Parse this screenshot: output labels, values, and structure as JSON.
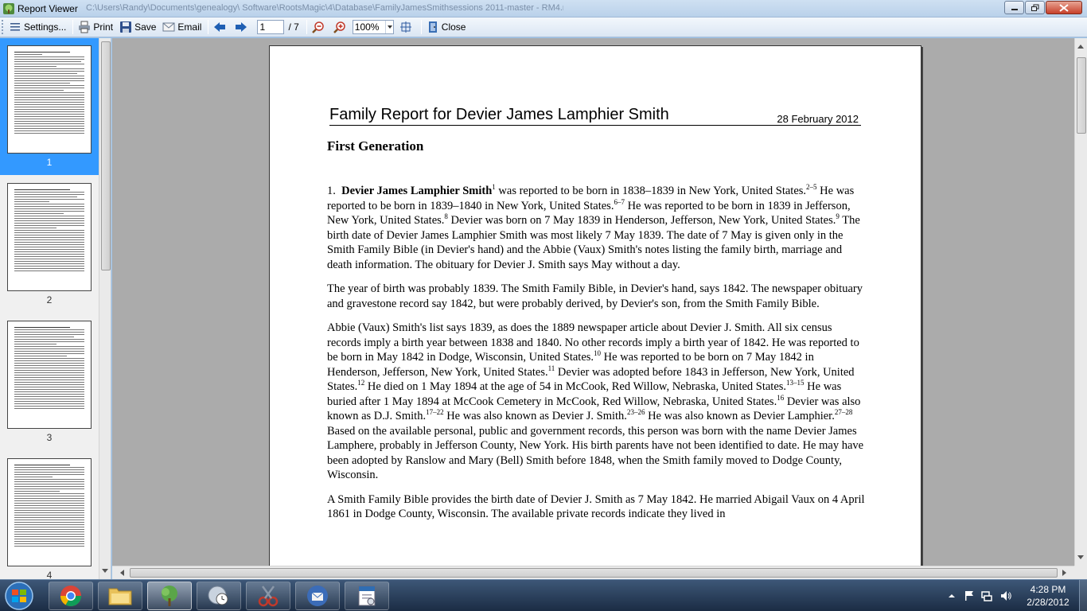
{
  "window": {
    "title": "Report Viewer",
    "path": "C:\\Users\\Randy\\Documents\\genealogy\\ Software\\RootsMagic\\4\\Database\\FamilyJamesSmithsessions 2011-master - RM4.rmgc"
  },
  "toolbar": {
    "settings": "Settings...",
    "print": "Print",
    "save": "Save",
    "email": "Email",
    "page_value": "1",
    "page_total": "/ 7",
    "zoom": "100%",
    "close": "Close"
  },
  "thumbnails": [
    {
      "num": "1",
      "selected": true
    },
    {
      "num": "2",
      "selected": false
    },
    {
      "num": "3",
      "selected": false
    },
    {
      "num": "4",
      "selected": false
    }
  ],
  "report": {
    "title": "Family Report for Devier James Lamphier Smith",
    "date": "28 February 2012",
    "generation": "First Generation",
    "p1": {
      "num": "1.",
      "name": "Devier James Lamphier Smith",
      "s1": "1",
      "t1": " was reported to be born in 1838–1839 in New York, United States.",
      "s2": "2–5",
      "t2": " He was reported to be born in 1839–1840 in New York, United States.",
      "s3": "6–7",
      "t3": " He was reported to be born in 1839 in Jefferson, New York, United States.",
      "s4": "8",
      "t4": " Devier was born on 7 May 1839 in Henderson, Jefferson, New York, United States.",
      "s5": "9",
      "t5": " The birth date of Devier James Lamphier Smith was most likely 7 May 1839.  The date of 7 May is given only in the Smith Family Bible (in Devier's hand) and the Abbie (Vaux) Smith's notes listing the family birth, marriage and death information.  The obituary for Devier J. Smith says May without a day."
    },
    "p2": "The year of birth was probably 1839.  The Smith Family Bible, in Devier's hand, says 1842.  The newspaper obituary and gravestone record say 1842, but were probably derived, by Devier's son, from the Smith Family Bible.",
    "p3": {
      "t1": "Abbie (Vaux) Smith's  list says 1839, as does the 1889 newspaper article about Devier J. Smith.  All six census records imply a birth year between 1838 and 1840.  No other records imply a birth year of 1842.  He was reported to be born in May 1842 in Dodge, Wisconsin, United States.",
      "s1": "10",
      "t2": " He was reported to be born on 7 May 1842 in Henderson, Jefferson, New York, United States.",
      "s2": "11",
      "t3": " Devier was adopted before 1843 in Jefferson, New York, United States.",
      "s3": "12",
      "t4": " He died on 1 May 1894 at the age of 54 in McCook, Red Willow, Nebraska, United States.",
      "s4": "13–15",
      "t5": " He was buried after 1 May 1894 at McCook Cemetery in McCook, Red Willow, Nebraska, United States.",
      "s5": "16",
      "t6": " Devier was also known as D.J. Smith.",
      "s6": "17–22",
      "t7": " He was also known as Devier J. Smith.",
      "s7": "23–26",
      "t8": " He was also known as Devier Lamphier.",
      "s8": "27–28",
      "t9": " Based on the available personal, public and government records, this person was born with the name Devier James Lamphere, probably in Jefferson County, New York.  His birth parents have not been identified to date.  He may have been adopted by Ranslow and Mary (Bell) Smith before 1848, when the Smith family moved to Dodge County, Wisconsin."
    },
    "p4": "A Smith Family Bible provides the birth date of Devier J. Smith as 7 May 1842.  He married Abigail Vaux on 4 April 1861 in Dodge County, Wisconsin.  The available private records indicate they lived in"
  },
  "taskbar": {
    "time": "4:28 PM",
    "date": "2/28/2012"
  }
}
